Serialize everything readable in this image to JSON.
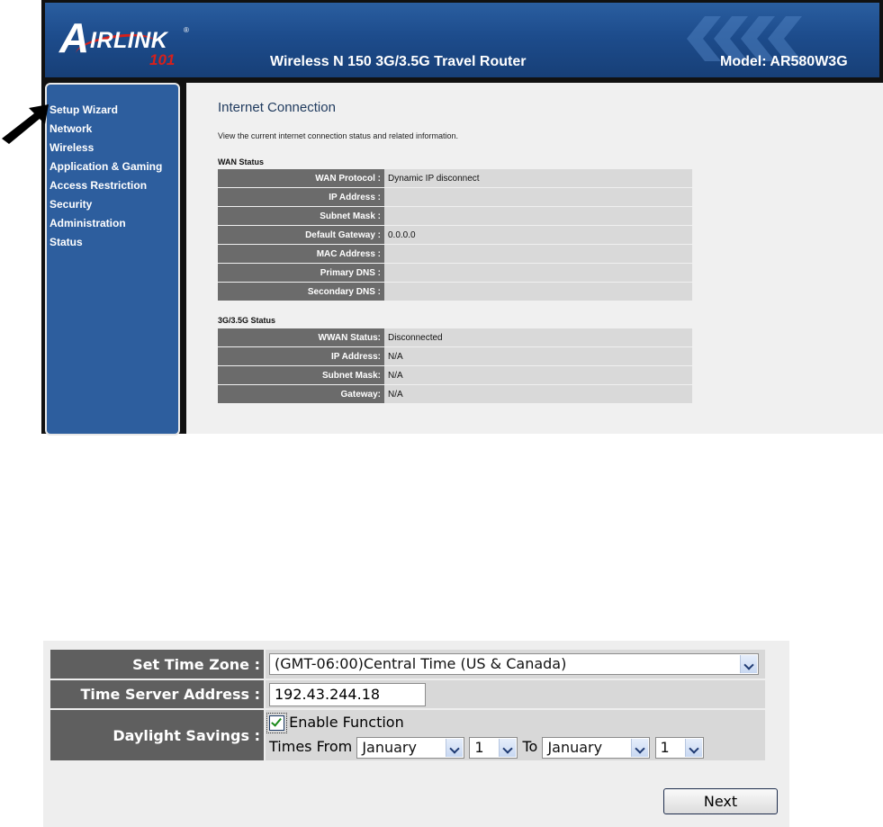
{
  "banner": {
    "logo_letter": "A",
    "logo_rest": "IRLINK",
    "logo_reg": "®",
    "logo_number": "101",
    "product_title": "Wireless N 150 3G/3.5G Travel Router",
    "model": "Model: AR580W3G"
  },
  "sidebar": {
    "items": [
      {
        "label": "Setup Wizard"
      },
      {
        "label": "Network"
      },
      {
        "label": "Wireless"
      },
      {
        "label": "Application & Gaming"
      },
      {
        "label": "Access Restriction"
      },
      {
        "label": "Security"
      },
      {
        "label": "Administration"
      },
      {
        "label": "Status"
      }
    ]
  },
  "main": {
    "title": "Internet Connection",
    "description": "View the current internet connection status and related information.",
    "wan": {
      "heading": "WAN Status",
      "rows": [
        {
          "label": "WAN Protocol :",
          "value": "Dynamic IP disconnect"
        },
        {
          "label": "IP Address :",
          "value": ""
        },
        {
          "label": "Subnet Mask :",
          "value": ""
        },
        {
          "label": "Default Gateway :",
          "value": "0.0.0.0"
        },
        {
          "label": "MAC Address :",
          "value": ""
        },
        {
          "label": "Primary DNS :",
          "value": ""
        },
        {
          "label": "Secondary DNS :",
          "value": ""
        }
      ]
    },
    "wwan": {
      "heading": "3G/3.5G Status",
      "rows": [
        {
          "label": "WWAN Status:",
          "value": "Disconnected"
        },
        {
          "label": "IP Address:",
          "value": "N/A"
        },
        {
          "label": "Subnet Mask:",
          "value": "N/A"
        },
        {
          "label": "Gateway:",
          "value": "N/A"
        }
      ]
    }
  },
  "time_form": {
    "time_zone_label": "Set Time Zone :",
    "time_zone_value": "(GMT-06:00)Central Time (US & Canada)",
    "server_label": "Time Server Address :",
    "server_value": "192.43.244.18",
    "daylight_label": "Daylight Savings :",
    "enable_label": "Enable Function",
    "enable_checked": true,
    "times_from_label": "Times From",
    "from_month": "January",
    "from_day": "1",
    "to_label": "To",
    "to_month": "January",
    "to_day": "1",
    "next_label": "Next"
  },
  "colors": {
    "banner_blue": "#1d4c8c",
    "sidebar_blue": "#2d5e9e",
    "label_gray": "#6b6b6b",
    "value_gray": "#d9d9d9",
    "logo_red": "#d6201b"
  }
}
